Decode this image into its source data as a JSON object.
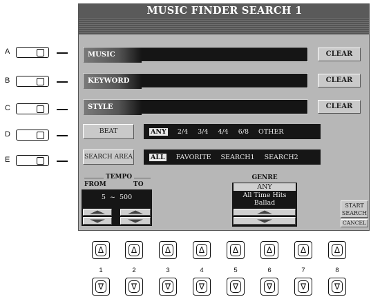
{
  "title": "MUSIC FINDER SEARCH 1",
  "side_buttons": [
    "A",
    "B",
    "C",
    "D",
    "E"
  ],
  "fields": [
    {
      "key": "music",
      "label": "MUSIC",
      "value": "",
      "clear": "CLEAR"
    },
    {
      "key": "keyword",
      "label": "KEYWORD",
      "value": "",
      "clear": "CLEAR"
    },
    {
      "key": "style",
      "label": "STYLE",
      "value": "",
      "clear": "CLEAR"
    }
  ],
  "beat": {
    "label": "BEAT",
    "options": [
      "ANY",
      "2/4",
      "3/4",
      "4/4",
      "6/8",
      "OTHER"
    ],
    "selected": "ANY"
  },
  "search_area": {
    "label": "SEARCH AREA",
    "options": [
      "ALL",
      "FAVORITE",
      "SEARCH1",
      "SEARCH2"
    ],
    "selected": "ALL"
  },
  "tempo": {
    "label": "TEMPO",
    "from_label": "FROM",
    "to_label": "TO",
    "from": "5",
    "separator": "~",
    "to": "500"
  },
  "genre": {
    "label": "GENRE",
    "items": [
      "ANY",
      "All Time Hits",
      "Ballad"
    ],
    "selected": "ANY"
  },
  "start_search": {
    "line1": "START",
    "line2": "SEARCH"
  },
  "cancel": "CANCEL",
  "bottom_buttons": {
    "numbers": [
      "1",
      "2",
      "3",
      "4",
      "5",
      "6",
      "7",
      "8"
    ],
    "up_glyph": "Δ",
    "down_glyph": "∇"
  }
}
